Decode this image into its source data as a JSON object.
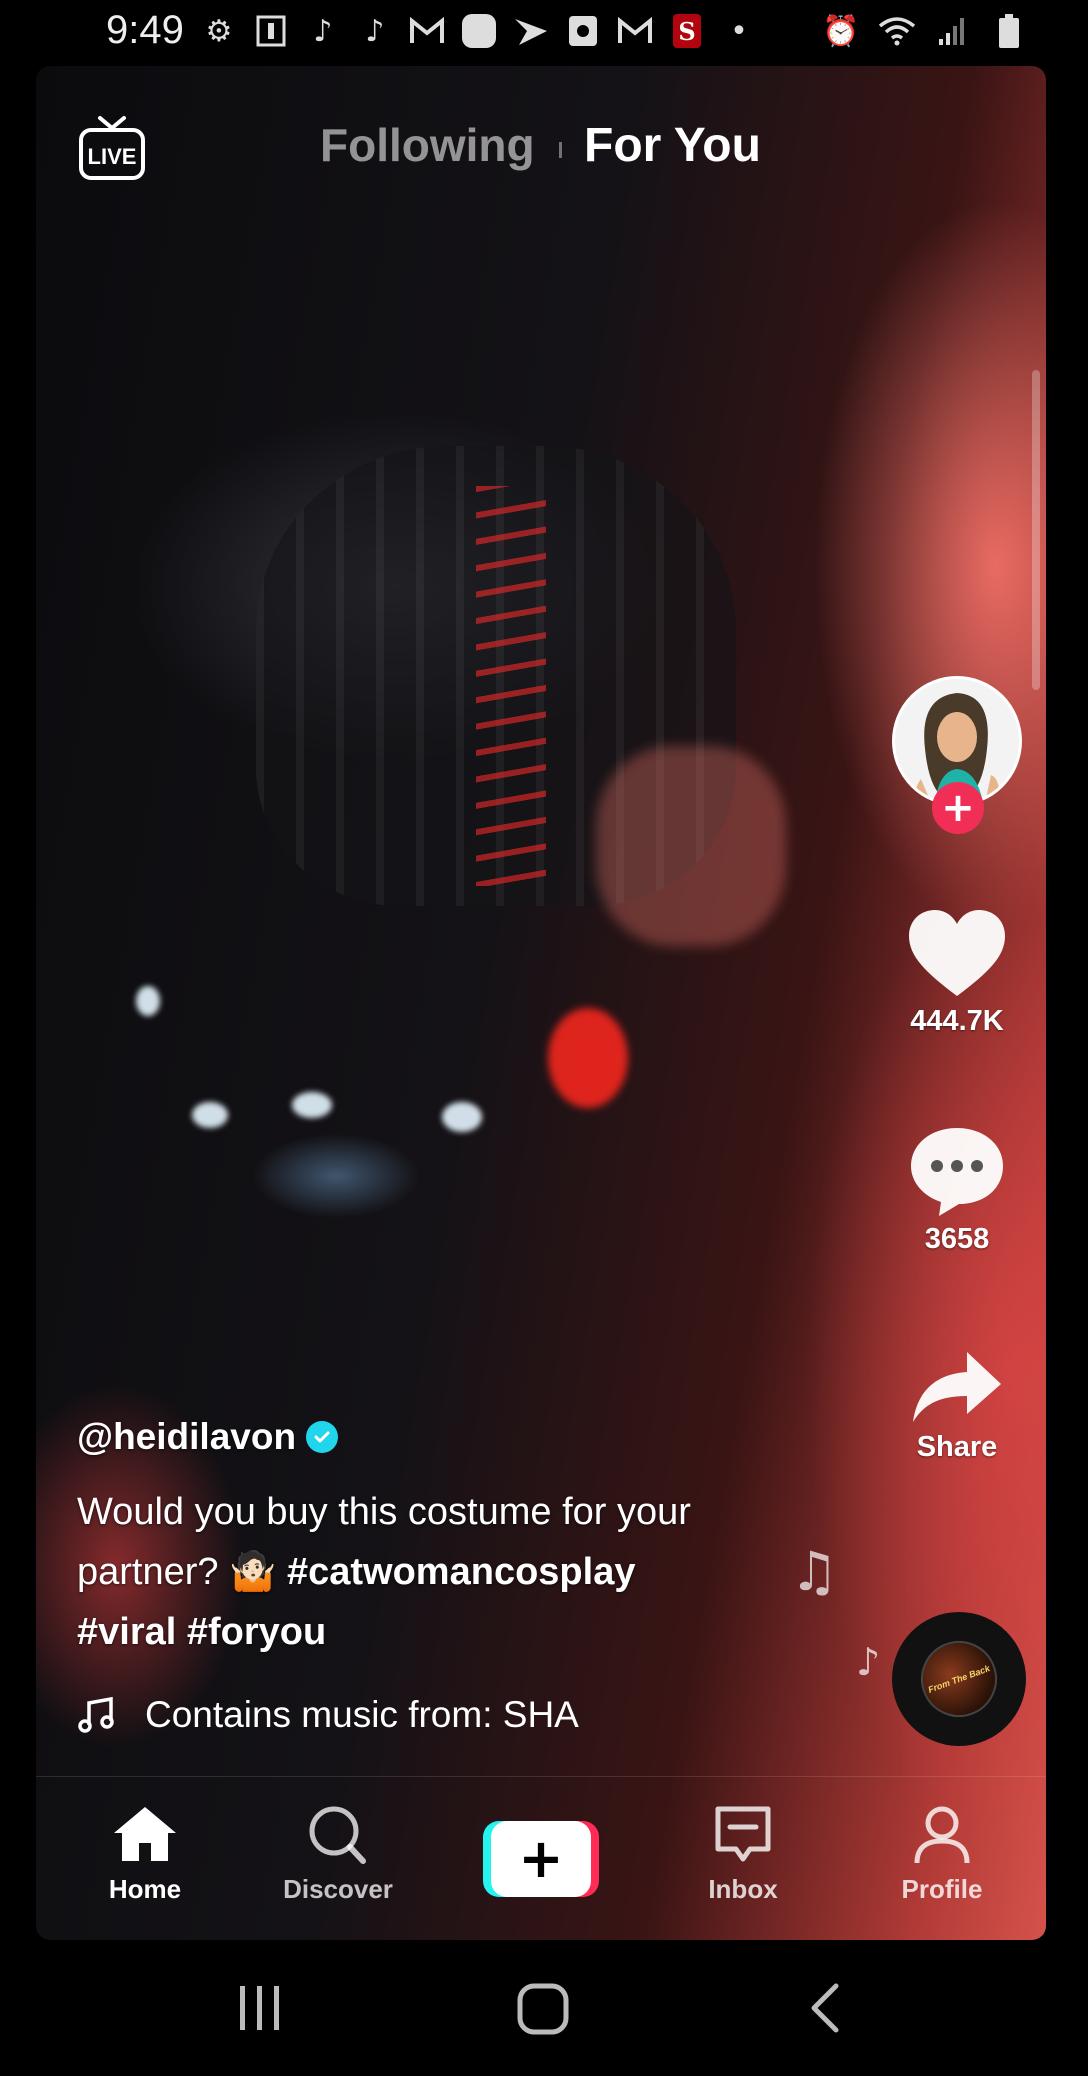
{
  "status_bar": {
    "time": "9:49",
    "left_icons": [
      "settings-icon",
      "notification-icon",
      "tiktok-icon",
      "tiktok-icon",
      "gmail-icon",
      "app-icon",
      "sprint-icon",
      "app-icon",
      "gmail-icon",
      "stanford-icon",
      "dot-icon"
    ],
    "right_icons": [
      "alarm-icon",
      "wifi-icon",
      "signal-icon",
      "battery-icon"
    ]
  },
  "top": {
    "live_label": "LIVE",
    "tabs": [
      {
        "label": "Following",
        "active": false
      },
      {
        "label": "For You",
        "active": true
      }
    ]
  },
  "actions": {
    "likes": "444.7K",
    "comments": "3658",
    "share_label": "Share"
  },
  "post": {
    "username": "@heidilavon",
    "verified": true,
    "caption_text_1": "Would you buy this costume for your partner? ",
    "caption_emoji": "🤷🏻",
    "hashtags": [
      "#catwomancosplay",
      "#viral",
      "#foryou"
    ],
    "music": "Contains music from: SHA",
    "disc_text": "From The Back"
  },
  "nav": {
    "items": [
      {
        "label": "Home",
        "icon": "home-icon",
        "active": true
      },
      {
        "label": "Discover",
        "icon": "search-icon",
        "active": false
      },
      {
        "label": "",
        "icon": "plus-icon",
        "active": false
      },
      {
        "label": "Inbox",
        "icon": "inbox-icon",
        "active": false
      },
      {
        "label": "Profile",
        "icon": "profile-icon",
        "active": false
      }
    ]
  },
  "colors": {
    "accent_pink": "#fe2c55",
    "accent_cyan": "#25f4ee",
    "verified_blue": "#20d5ec",
    "follow_red": "#f12f56"
  }
}
